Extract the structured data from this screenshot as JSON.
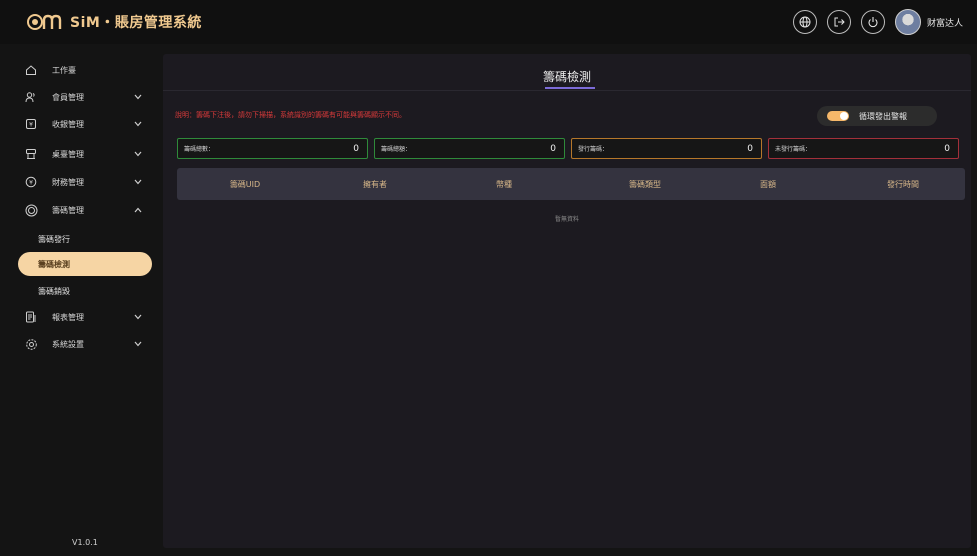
{
  "app": {
    "brand_text": "SiM・賬房管理系統",
    "username": "财富达人"
  },
  "header_icons": [
    "globe-icon",
    "logout-icon",
    "power-icon"
  ],
  "sidebar": {
    "items": [
      {
        "label": "工作臺",
        "icon": "home-icon",
        "has_chevron": false
      },
      {
        "label": "會員管理",
        "icon": "users-icon",
        "has_chevron": true
      },
      {
        "label": "收銀管理",
        "icon": "cashier-icon",
        "has_chevron": true
      },
      {
        "label": "桌臺管理",
        "icon": "table-icon",
        "has_chevron": true
      },
      {
        "label": "財務管理",
        "icon": "finance-icon",
        "has_chevron": true
      },
      {
        "label": "籌碼管理",
        "icon": "chip-icon",
        "has_chevron": true,
        "expanded": true
      },
      {
        "label": "報表管理",
        "icon": "report-icon",
        "has_chevron": true
      },
      {
        "label": "系統設置",
        "icon": "settings-icon",
        "has_chevron": true
      }
    ],
    "sub_items": [
      "籌碼發行",
      "籌碼檢測",
      "籌碼銷毀"
    ],
    "active_sub": "籌碼檢測",
    "version": "V1.0.1"
  },
  "main": {
    "title": "籌碼檢測",
    "notice": "說明：籌碼下注後，請勿下掃描，系統識別的籌碼有可能與籌碼顯示不同。",
    "toggle_label": "循環發出警報",
    "toggle_on": true,
    "stats": [
      {
        "label": "籌碼總數：",
        "value": "0",
        "color": "#2f8a3a"
      },
      {
        "label": "籌碼總額：",
        "value": "0",
        "color": "#2f8a3a"
      },
      {
        "label": "發行籌碼：",
        "value": "0",
        "color": "#b5772a"
      },
      {
        "label": "未發行籌碼：",
        "value": "0",
        "color": "#a3303a"
      }
    ],
    "table": {
      "headers": [
        "籌碼UID",
        "擁有者",
        "幣種",
        "籌碼類型",
        "面額",
        "發行時間"
      ],
      "empty_text": "暫無資料"
    }
  },
  "colors": {
    "accent": "#f6d5a4",
    "brand": "#f0c98f",
    "header_text": "#d7b789",
    "notice": "#d83a3a"
  }
}
